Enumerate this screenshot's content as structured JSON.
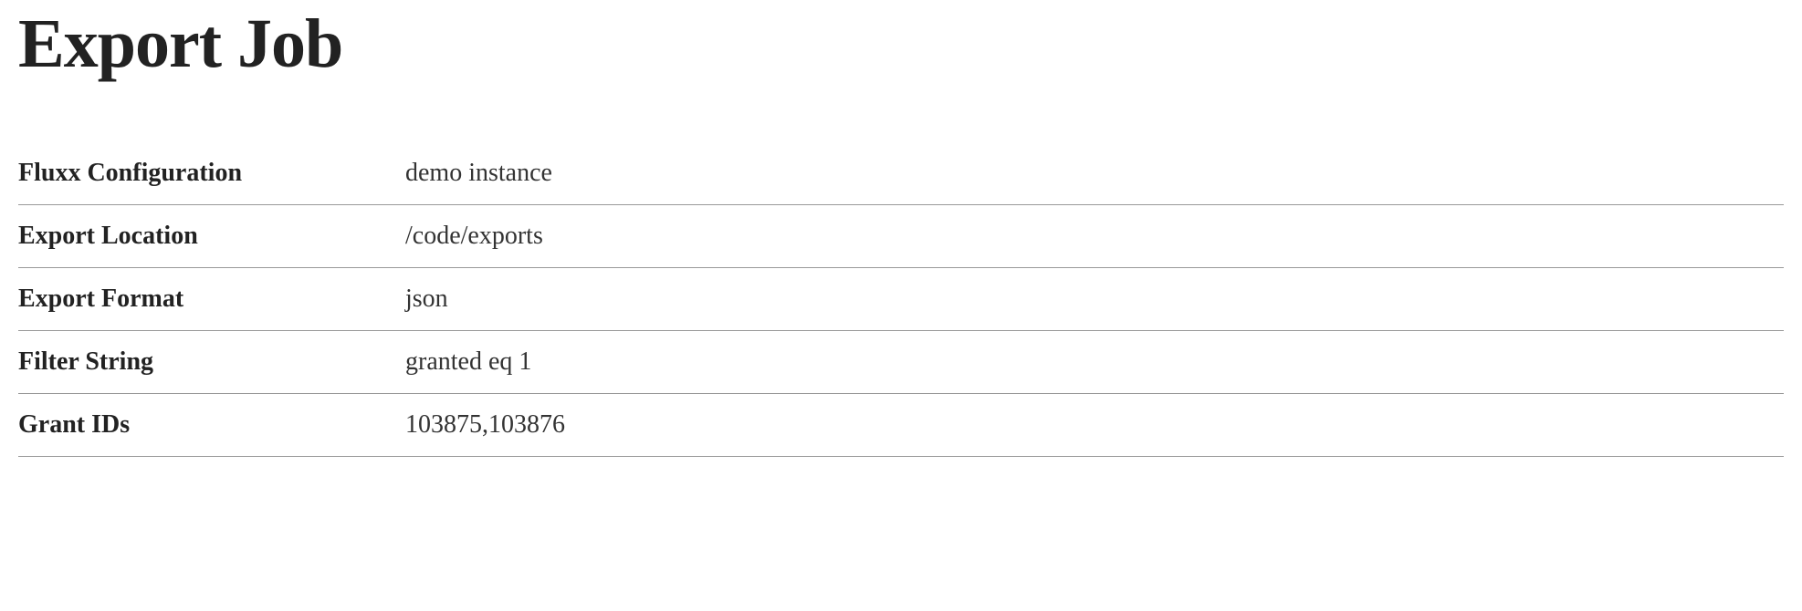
{
  "page": {
    "title": "Export Job"
  },
  "details": {
    "rows": [
      {
        "label": "Fluxx Configuration",
        "value": "demo instance"
      },
      {
        "label": "Export Location",
        "value": "/code/exports"
      },
      {
        "label": "Export Format",
        "value": "json"
      },
      {
        "label": "Filter String",
        "value": "granted eq 1"
      },
      {
        "label": "Grant IDs",
        "value": "103875,103876"
      }
    ]
  }
}
